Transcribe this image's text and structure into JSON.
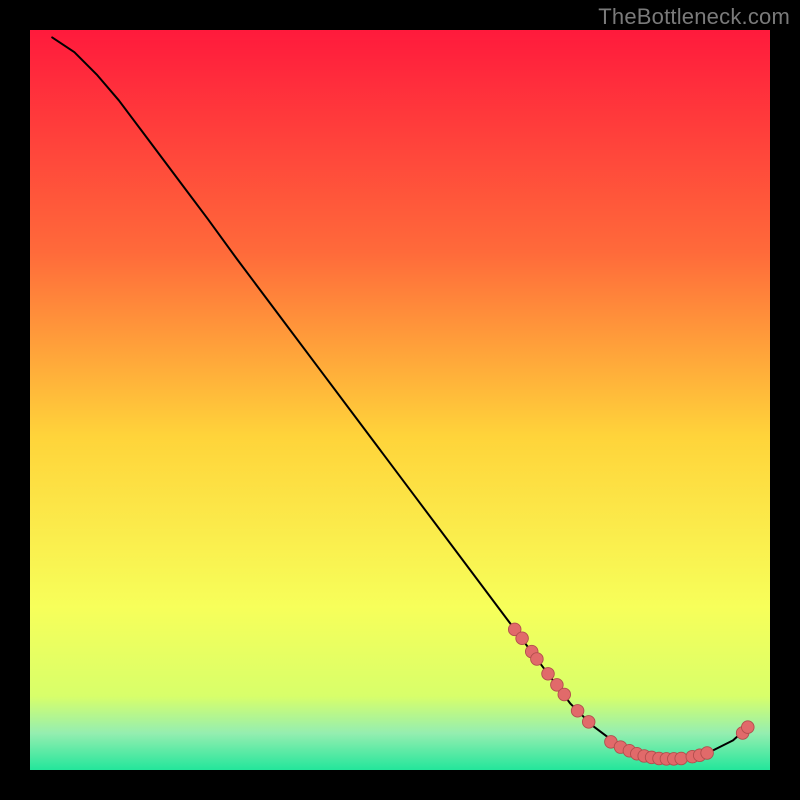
{
  "watermark": "TheBottleneck.com",
  "colors": {
    "background": "#000000",
    "watermark_text": "#7a7a7a",
    "gradient_top": "#ff1a3c",
    "gradient_upper": "#ff6a3a",
    "gradient_mid": "#ffd43a",
    "gradient_low": "#f7ff5a",
    "gradient_band1": "#d8ff6a",
    "gradient_band2": "#95eeb0",
    "gradient_bottom": "#23e69b",
    "curve": "#000000",
    "marker_fill": "#e16a6a",
    "marker_stroke": "#b24d4d"
  },
  "chart_data": {
    "type": "line",
    "title": "",
    "xlabel": "",
    "ylabel": "",
    "xlim": [
      0,
      100
    ],
    "ylim": [
      0,
      100
    ],
    "grid": false,
    "legend": false,
    "curve": [
      {
        "x": 3.0,
        "y": 99.0
      },
      {
        "x": 6.0,
        "y": 97.0
      },
      {
        "x": 9.0,
        "y": 94.0
      },
      {
        "x": 12.0,
        "y": 90.5
      },
      {
        "x": 15.0,
        "y": 86.5
      },
      {
        "x": 18.0,
        "y": 82.5
      },
      {
        "x": 21.0,
        "y": 78.5
      },
      {
        "x": 24.0,
        "y": 74.5
      },
      {
        "x": 28.0,
        "y": 69.0
      },
      {
        "x": 34.0,
        "y": 61.0
      },
      {
        "x": 40.0,
        "y": 53.0
      },
      {
        "x": 46.0,
        "y": 45.0
      },
      {
        "x": 52.0,
        "y": 37.0
      },
      {
        "x": 58.0,
        "y": 29.0
      },
      {
        "x": 64.0,
        "y": 21.0
      },
      {
        "x": 70.0,
        "y": 13.0
      },
      {
        "x": 73.0,
        "y": 9.0
      },
      {
        "x": 76.0,
        "y": 6.0
      },
      {
        "x": 80.0,
        "y": 3.0
      },
      {
        "x": 84.0,
        "y": 1.5
      },
      {
        "x": 88.0,
        "y": 1.5
      },
      {
        "x": 92.0,
        "y": 2.5
      },
      {
        "x": 95.0,
        "y": 4.0
      },
      {
        "x": 97.0,
        "y": 5.8
      }
    ],
    "markers": [
      {
        "x": 65.5,
        "y": 19.0
      },
      {
        "x": 66.5,
        "y": 17.8
      },
      {
        "x": 67.8,
        "y": 16.0
      },
      {
        "x": 68.5,
        "y": 15.0
      },
      {
        "x": 70.0,
        "y": 13.0
      },
      {
        "x": 71.2,
        "y": 11.5
      },
      {
        "x": 72.2,
        "y": 10.2
      },
      {
        "x": 74.0,
        "y": 8.0
      },
      {
        "x": 75.5,
        "y": 6.5
      },
      {
        "x": 78.5,
        "y": 3.8
      },
      {
        "x": 79.8,
        "y": 3.1
      },
      {
        "x": 81.0,
        "y": 2.6
      },
      {
        "x": 82.0,
        "y": 2.2
      },
      {
        "x": 83.0,
        "y": 1.9
      },
      {
        "x": 84.0,
        "y": 1.7
      },
      {
        "x": 85.0,
        "y": 1.55
      },
      {
        "x": 86.0,
        "y": 1.5
      },
      {
        "x": 87.0,
        "y": 1.5
      },
      {
        "x": 88.0,
        "y": 1.55
      },
      {
        "x": 89.5,
        "y": 1.8
      },
      {
        "x": 90.5,
        "y": 2.0
      },
      {
        "x": 91.5,
        "y": 2.3
      },
      {
        "x": 96.3,
        "y": 5.0
      },
      {
        "x": 97.0,
        "y": 5.8
      }
    ]
  }
}
